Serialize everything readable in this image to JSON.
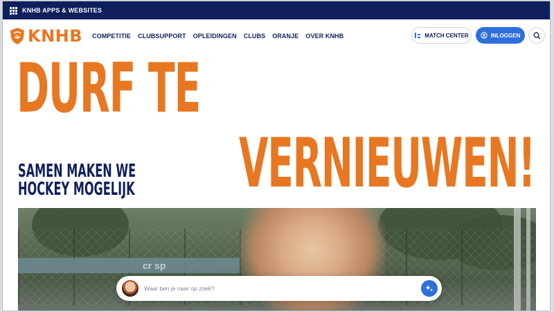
{
  "apps_bar": {
    "label": "KNHB APPS & WEBSITES",
    "icon": "apps-grid-icon"
  },
  "nav": {
    "logo_text": "KNHB",
    "logo_icon": "knhb-shield-icon",
    "menu": [
      "COMPETITIE",
      "CLUBSUPPORT",
      "OPLEIDINGEN",
      "CLUBS",
      "ORANJE",
      "OVER KNHB"
    ],
    "match_center": {
      "label": "MATCH CENTER",
      "icon": "scoreboard-icon"
    },
    "login": {
      "label": "INLOGGEN",
      "icon": "user-circle-icon"
    },
    "search_icon": "search-icon"
  },
  "hero": {
    "headline_line1": "DURF TE",
    "headline_line2": "VERNIEUWEN!",
    "subheading": "SAMEN MAKEN WE HOCKEY MOGELIJK",
    "banner_text": "cr sp"
  },
  "search": {
    "placeholder": "Waar ben je naar op zoek?",
    "submit_icon": "sparkle-icon"
  },
  "colors": {
    "navy": "#0e1f5b",
    "orange": "#e87722",
    "blue": "#2f6fdc"
  }
}
